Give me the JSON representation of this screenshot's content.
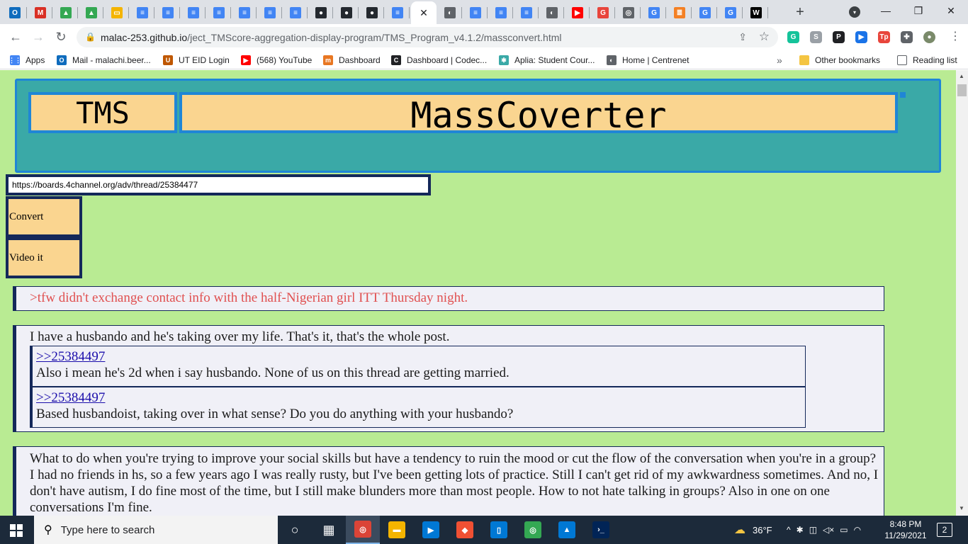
{
  "tabs": [
    {
      "icon": "outlook-icon",
      "glyph": "O",
      "color": "#0f6cbd"
    },
    {
      "icon": "gmail-icon",
      "glyph": "M",
      "color": "#d93025"
    },
    {
      "icon": "drive-icon",
      "glyph": "▲",
      "color": "#34a853"
    },
    {
      "icon": "drive-icon",
      "glyph": "▲",
      "color": "#34a853"
    },
    {
      "icon": "slides-icon",
      "glyph": "▭",
      "color": "#f4b400"
    },
    {
      "icon": "docs-icon",
      "glyph": "≡",
      "color": "#4285f4"
    },
    {
      "icon": "docs-icon",
      "glyph": "≡",
      "color": "#4285f4"
    },
    {
      "icon": "docs-icon",
      "glyph": "≡",
      "color": "#4285f4"
    },
    {
      "icon": "docs-icon",
      "glyph": "≡",
      "color": "#4285f4"
    },
    {
      "icon": "docs-icon",
      "glyph": "≡",
      "color": "#4285f4"
    },
    {
      "icon": "docs-icon",
      "glyph": "≡",
      "color": "#4285f4"
    },
    {
      "icon": "docs-icon",
      "glyph": "≡",
      "color": "#4285f4"
    },
    {
      "icon": "github-icon",
      "glyph": "●",
      "color": "#24292f"
    },
    {
      "icon": "github-icon",
      "glyph": "●",
      "color": "#24292f"
    },
    {
      "icon": "github-icon",
      "glyph": "●",
      "color": "#24292f"
    },
    {
      "icon": "docs-icon",
      "glyph": "≡",
      "color": "#4285f4"
    },
    {
      "icon": "close-icon",
      "glyph": "✕",
      "color": "#ffffff",
      "active": true
    },
    {
      "icon": "globe-icon",
      "glyph": "◐",
      "color": "#5f6368"
    },
    {
      "icon": "docs-icon",
      "glyph": "≡",
      "color": "#4285f4"
    },
    {
      "icon": "docs-icon",
      "glyph": "≡",
      "color": "#4285f4"
    },
    {
      "icon": "docs-icon",
      "glyph": "≡",
      "color": "#4285f4"
    },
    {
      "icon": "globe-icon",
      "glyph": "◐",
      "color": "#5f6368"
    },
    {
      "icon": "youtube-icon",
      "glyph": "▶",
      "color": "#ff0000"
    },
    {
      "icon": "grammarly-icon",
      "glyph": "G",
      "color": "#e8453c"
    },
    {
      "icon": "chrome-icon",
      "glyph": "◎",
      "color": "#5f6368"
    },
    {
      "icon": "google-icon",
      "glyph": "G",
      "color": "#4285f4"
    },
    {
      "icon": "stackoverflow-icon",
      "glyph": "≣",
      "color": "#f48024"
    },
    {
      "icon": "google-icon",
      "glyph": "G",
      "color": "#4285f4"
    },
    {
      "icon": "google-icon",
      "glyph": "G",
      "color": "#4285f4"
    },
    {
      "icon": "wikipedia-icon",
      "glyph": "W",
      "color": "#000000"
    }
  ],
  "window": {
    "minimize": "—",
    "maximize": "❐",
    "close": "✕",
    "new_tab": "+",
    "tab_search": "▾"
  },
  "toolbar": {
    "back": "←",
    "forward": "→",
    "reload": "↻",
    "lock": "🔒",
    "url_host": "malac-253.github.io",
    "url_path": "/ject_TMScore-aggregation-display-program/TMS_Program_v4.1.2/massconvert.html",
    "share": "⇪",
    "star": "☆",
    "menu": "⋮"
  },
  "extensions": [
    {
      "icon": "grammarly-icon",
      "glyph": "G",
      "color": "#15c39a"
    },
    {
      "icon": "s-icon",
      "glyph": "S",
      "color": "#9aa0a6"
    },
    {
      "icon": "p-icon",
      "glyph": "P",
      "color": "#202124"
    },
    {
      "icon": "play-icon",
      "glyph": "▶",
      "color": "#1a73e8"
    },
    {
      "icon": "tp-icon",
      "glyph": "Tp",
      "color": "#e8453c"
    },
    {
      "icon": "puzzle-icon",
      "glyph": "✚",
      "color": "#5f6368"
    },
    {
      "icon": "profile-avatar-icon",
      "glyph": "●",
      "color": "#7a8a6a"
    }
  ],
  "bookmarks": [
    {
      "icon": "apps-icon",
      "glyph": "⋮⋮",
      "color": "#4285f4",
      "label": "Apps"
    },
    {
      "icon": "outlook-icon",
      "glyph": "O",
      "color": "#0f6cbd",
      "label": "Mail - malachi.beer..."
    },
    {
      "icon": "ut-icon",
      "glyph": "U",
      "color": "#bf5700",
      "label": "UT EID Login"
    },
    {
      "icon": "youtube-icon",
      "glyph": "▶",
      "color": "#ff0000",
      "label": "(568) YouTube"
    },
    {
      "icon": "dashboard-icon",
      "glyph": "m",
      "color": "#e87722",
      "label": "Dashboard"
    },
    {
      "icon": "codecademy-icon",
      "glyph": "C",
      "color": "#202124",
      "label": "Dashboard | Codec..."
    },
    {
      "icon": "aplia-icon",
      "glyph": "✱",
      "color": "#3aa9a7",
      "label": "Aplia: Student Cour..."
    },
    {
      "icon": "globe-icon",
      "glyph": "◐",
      "color": "#5f6368",
      "label": "Home | Centrenet"
    }
  ],
  "bookmarks_more": "»",
  "other_bookmarks": "Other bookmarks",
  "reading_list": "Reading list",
  "app": {
    "title_left": "TMS",
    "title_right": "MassCoverter",
    "url_value": "https://boards.4channel.org/adv/thread/25384477",
    "convert_label": "Convert",
    "video_label": "Video it"
  },
  "posts": [
    {
      "text": ">tfw didn't exchange contact info with the half-Nigerian girl ITT Thursday night."
    },
    {
      "text": "I have a husbando and he's taking over my life. That's it, that's the whole post.",
      "replies": [
        {
          "link": ">>25384497",
          "text": "Also i mean he's 2d when i say husbando. None of us on this thread are getting married."
        },
        {
          "link": ">>25384497",
          "text": "Based husbandoist, taking over in what sense? Do you do anything with your husbando?"
        }
      ]
    },
    {
      "text": "What to do when you're trying to improve your social skills but have a tendency to ruin the mood or cut the flow of the conversation when you're in a group? I had no friends in hs, so a few years ago I was really rusty, but I've been getting lots of practice. Still I can't get rid of my awkwardness sometimes. And no, I don't have autism, I do fine most of the time, but I still make blunders more than most people. How to not hate talking in groups? Also in one on one conversations I'm fine."
    }
  ],
  "taskbar": {
    "search_placeholder": "Type here to search",
    "apps": [
      {
        "icon": "task-view-icon",
        "glyph": "○",
        "color": "transparent"
      },
      {
        "icon": "timeline-icon",
        "glyph": "▦",
        "color": "transparent"
      },
      {
        "icon": "chrome-icon",
        "glyph": "◎",
        "color": "#db4437",
        "active": true
      },
      {
        "icon": "file-explorer-icon",
        "glyph": "▬",
        "color": "#f4b400"
      },
      {
        "icon": "movies-icon",
        "glyph": "▶",
        "color": "#0078d4"
      },
      {
        "icon": "git-icon",
        "glyph": "◆",
        "color": "#f05033"
      },
      {
        "icon": "dev-app-icon",
        "glyph": "▯",
        "color": "#0078d4"
      },
      {
        "icon": "chrome-icon",
        "glyph": "◎",
        "color": "#34a853"
      },
      {
        "icon": "photos-icon",
        "glyph": "▲",
        "color": "#0078d4"
      },
      {
        "icon": "powershell-icon",
        "glyph": "›_",
        "color": "#012456"
      }
    ],
    "weather": "36°F",
    "tray_chevron": "^",
    "time": "8:48 PM",
    "date": "11/29/2021",
    "notifications": "2"
  }
}
